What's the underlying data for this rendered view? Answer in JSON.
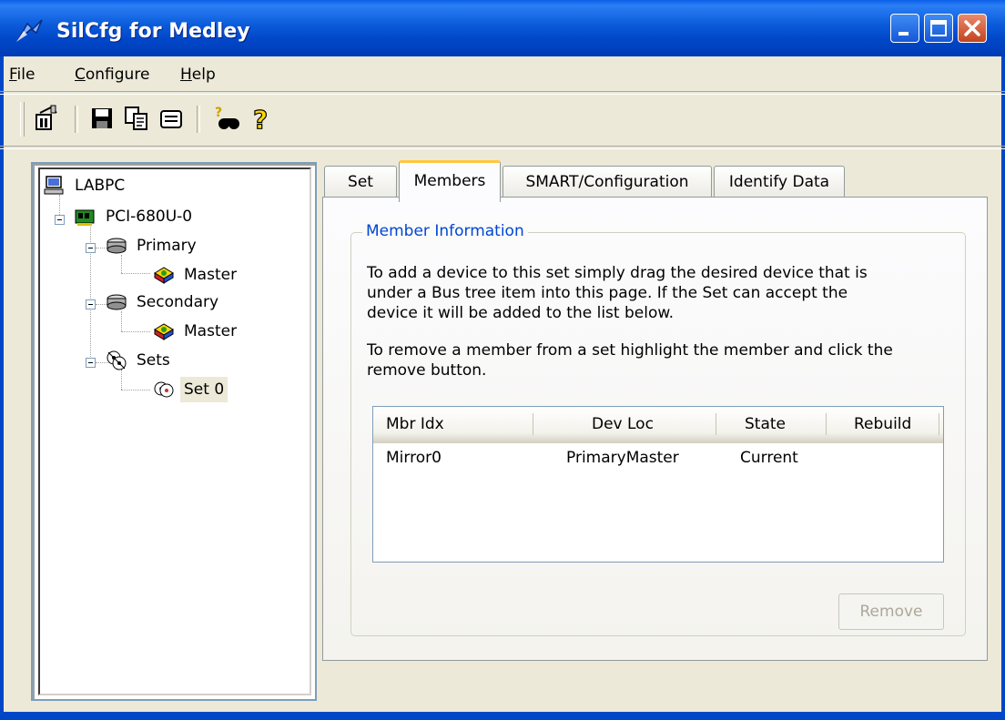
{
  "window": {
    "title": "SilCfg for Medley"
  },
  "menu": {
    "file": {
      "mnemonic": "F",
      "rest": "ile"
    },
    "configure": {
      "mnemonic": "C",
      "rest": "onfigure"
    },
    "help": {
      "mnemonic": "H",
      "rest": "elp"
    }
  },
  "toolbar": {
    "icons": [
      "scan-icon",
      "save-icon",
      "copy-icon",
      "print-icon",
      "find-icon",
      "help-icon"
    ]
  },
  "tree": {
    "root": "LABPC",
    "adapter": "PCI-680U-0",
    "primary": "Primary",
    "primary_master": "Master",
    "secondary": "Secondary",
    "secondary_master": "Master",
    "sets": "Sets",
    "set0": "Set 0"
  },
  "tabs": {
    "set": "Set",
    "members": "Members",
    "smart": "SMART/Configuration",
    "identify": "Identify Data"
  },
  "members_panel": {
    "group_title": "Member Information",
    "para1_line1": "To add a device to this set simply drag the desired device that is",
    "para1_line2": "under a Bus tree item into this page.  If the Set can accept the",
    "para1_line3": "device it will be added to the list below.",
    "para2_line1": "To remove a member from a set highlight the member and click the",
    "para2_line2": "remove button.",
    "columns": [
      "Mbr Idx",
      "Dev Loc",
      "State",
      "Rebuild"
    ],
    "rows": [
      {
        "mbr_idx": "Mirror0",
        "dev_loc": "PrimaryMaster",
        "state": "Current",
        "rebuild": ""
      }
    ],
    "remove_label": "Remove"
  },
  "colors": {
    "titlebar": "#0a5ad9",
    "group_title": "#0046d5",
    "tab_highlight": "#ffc83c",
    "face": "#ece9d8"
  }
}
